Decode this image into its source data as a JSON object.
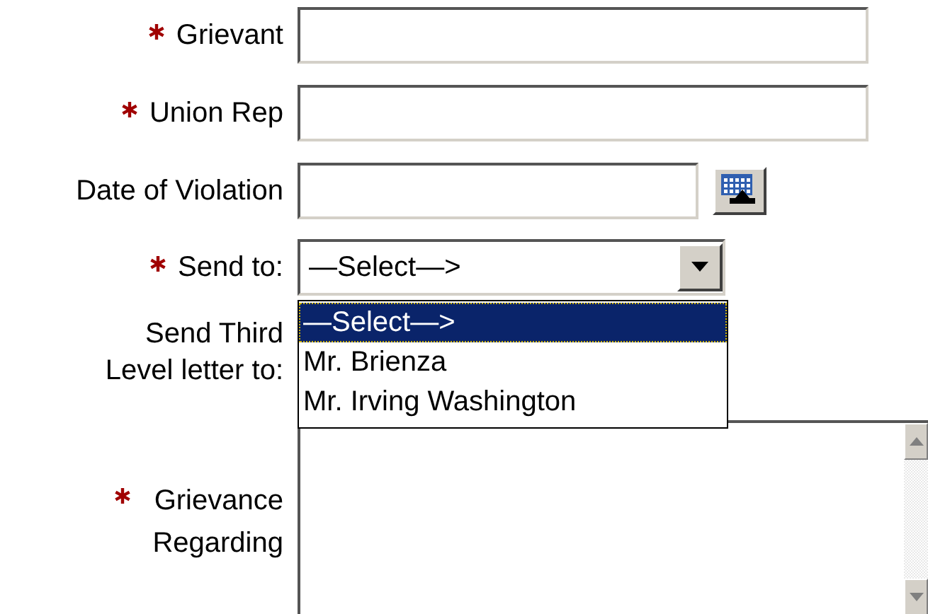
{
  "fields": [
    {
      "kind": "text",
      "label": "Grievant",
      "required": true
    },
    {
      "kind": "text",
      "label": "Union Rep",
      "required": true
    },
    {
      "kind": "date",
      "label": "Date of Violation",
      "required": false
    },
    {
      "kind": "select",
      "label": "Send to:",
      "required": true,
      "value": "—Select—>",
      "expanded": true,
      "options": [
        {
          "label": "—Select—>",
          "selected": true
        },
        {
          "label": "Mr. Brienza",
          "selected": false
        },
        {
          "label": "Mr. Irving Washington",
          "selected": false
        }
      ]
    },
    {
      "kind": "covered",
      "label": "Send Third Level letter to:",
      "required": false
    },
    {
      "kind": "textarea",
      "label": "Grievance Regarding",
      "required": true
    }
  ]
}
